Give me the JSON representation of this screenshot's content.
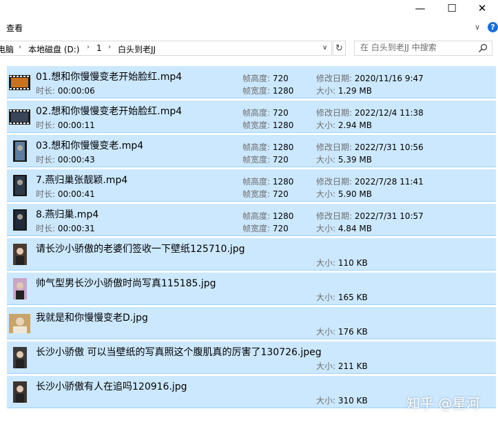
{
  "window": {
    "minimize": "—",
    "maximize": "☐",
    "close": "✕"
  },
  "ribbon": {
    "tab_view": "查看",
    "expand_glyph": "∨",
    "help_glyph": "?"
  },
  "address": {
    "crumbs": [
      "电脑",
      "本地磁盘 (D:)",
      "1",
      "白头到老JJ"
    ],
    "separator": "›"
  },
  "search": {
    "placeholder": "在 白头到老JJ 中搜索"
  },
  "labels": {
    "height": "帧高度: ",
    "width": "帧宽度: ",
    "modified": "修改日期: ",
    "size": "大小: ",
    "duration": "时长: "
  },
  "files": [
    {
      "name": "01.想和你慢慢变老开始脸红.mp4",
      "duration": "00:00:06",
      "height": "720",
      "width": "1280",
      "modified": "2020/11/16 9:47",
      "size": "1.29 MB",
      "thumb": "video-landscape",
      "thumb_color": "#c9711f"
    },
    {
      "name": "02.想和你慢慢变老开始脸红.mp4",
      "duration": "00:00:11",
      "height": "720",
      "width": "1280",
      "modified": "2022/12/4 11:38",
      "size": "2.94 MB",
      "thumb": "video-landscape",
      "thumb_color": "#3a4658"
    },
    {
      "name": "03.想和你慢慢变老.mp4",
      "duration": "00:00:43",
      "height": "1280",
      "width": "720",
      "modified": "2022/7/31 10:56",
      "size": "5.39 MB",
      "thumb": "video-portrait",
      "thumb_color": "#5d7ea0"
    },
    {
      "name": "7.燕归巢张靓颖.mp4",
      "duration": "00:00:41",
      "height": "1280",
      "width": "720",
      "modified": "2022/7/28 11:41",
      "size": "5.90 MB",
      "thumb": "video-portrait",
      "thumb_color": "#2d3a4a"
    },
    {
      "name": "8.燕归巢.mp4",
      "duration": "00:00:31",
      "height": "1280",
      "width": "720",
      "modified": "2022/7/31 10:57",
      "size": "4.84 MB",
      "thumb": "video-portrait",
      "thumb_color": "#1f2a3a"
    },
    {
      "name": "请长沙小骄傲的老婆们签收一下壁纸125710.jpg",
      "size": "110 KB",
      "thumb": "image-portrait",
      "thumb_color": "#4a3a30"
    },
    {
      "name": "帅气型男长沙小骄傲时尚写真115185.jpg",
      "size": "165 KB",
      "thumb": "image-portrait",
      "thumb_color": "#c9a6c8"
    },
    {
      "name": "我就是和你慢慢变老D.jpg",
      "size": "176 KB",
      "thumb": "image-square",
      "thumb_color": "#c8a36a"
    },
    {
      "name": "长沙小骄傲 可以当壁纸的写真照这个腹肌真的厉害了130726.jpeg",
      "size": "211 KB",
      "thumb": "image-portrait",
      "thumb_color": "#3a3a3a"
    },
    {
      "name": "长沙小骄傲有人在追吗120916.jpg",
      "size": "310 KB",
      "thumb": "image-portrait",
      "thumb_color": "#3b3430"
    }
  ],
  "watermark": "知乎 @星河"
}
